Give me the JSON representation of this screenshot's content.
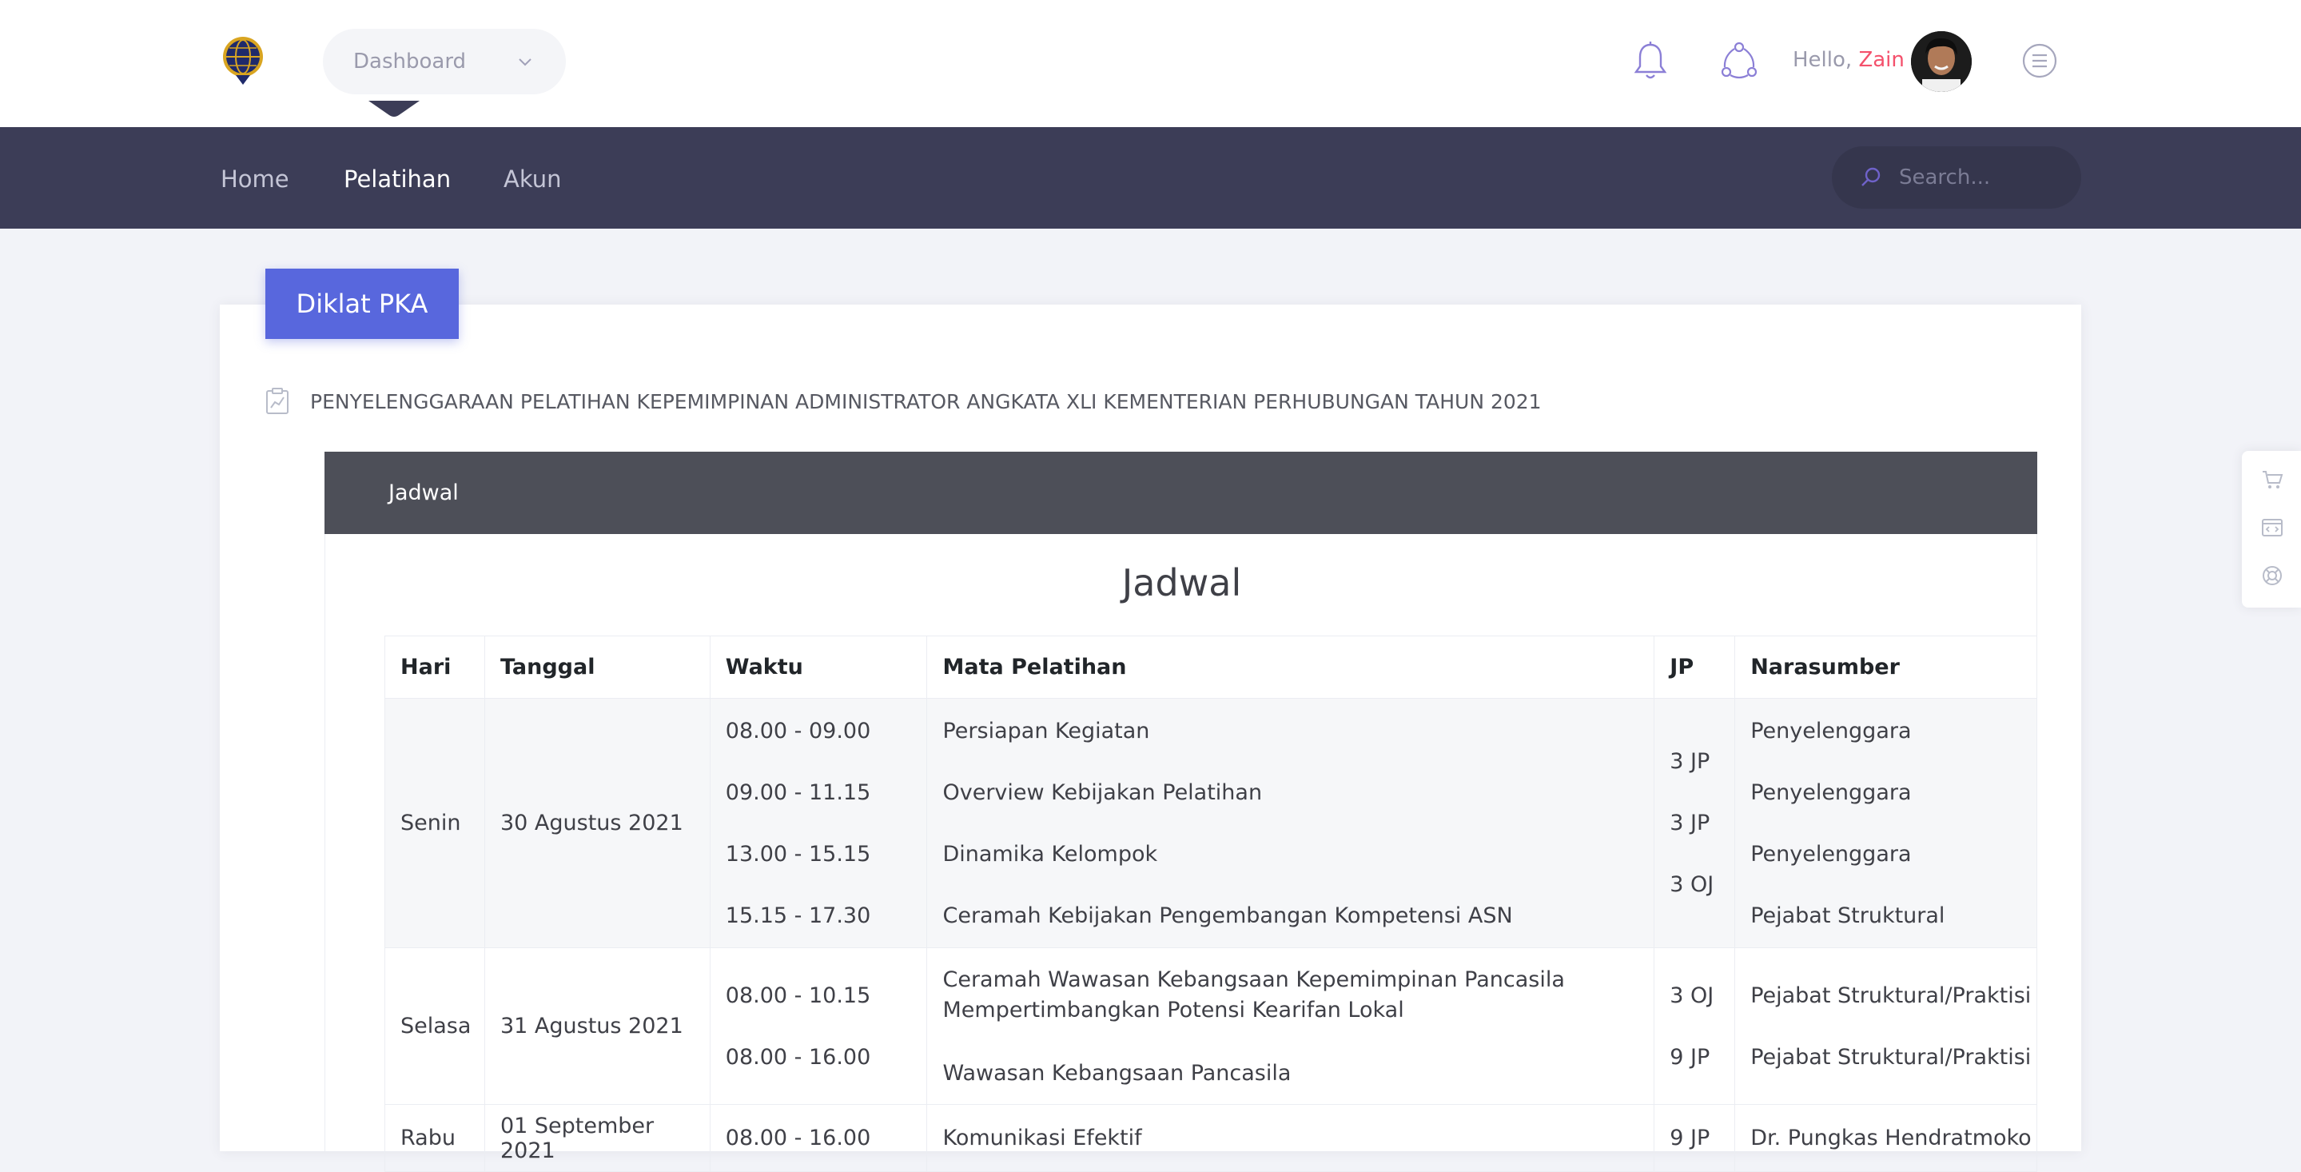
{
  "header": {
    "dashboard_select": "Dashboard",
    "greeting": "Hello,",
    "user_name": "Zain"
  },
  "nav": {
    "items": [
      {
        "label": "Home"
      },
      {
        "label": "Pelatihan"
      },
      {
        "label": "Akun"
      }
    ],
    "active_index": 1,
    "search_placeholder": "Search..."
  },
  "main": {
    "tab_label": "Diklat PKA",
    "course_title": "PENYELENGGARAAN PELATIHAN KEPEMIMPINAN ADMINISTRATOR ANGKATA XLI KEMENTERIAN PERHUBUNGAN TAHUN 2021",
    "section_header": "Jadwal",
    "table_title": "Jadwal",
    "columns": [
      "Hari",
      "Tanggal",
      "Waktu",
      "Mata Pelatihan",
      "JP",
      "Narasumber"
    ],
    "rows": [
      {
        "hari": "Senin",
        "tanggal": "30 Agustus 2021",
        "waktu": [
          "08.00 - 09.00",
          "09.00 - 11.15",
          "13.00 - 15.15",
          "15.15 - 17.30"
        ],
        "mata": [
          "Persiapan Kegiatan",
          "Overview Kebijakan Pelatihan",
          "Dinamika Kelompok",
          "Ceramah Kebijakan Pengembangan Kompetensi ASN"
        ],
        "jp": [
          "3 JP",
          "3 JP",
          "3 OJ"
        ],
        "narasumber": [
          "Penyelenggara",
          "Penyelenggara",
          "Penyelenggara",
          "Pejabat Struktural"
        ]
      },
      {
        "hari": "Selasa",
        "tanggal": "31 Agustus 2021",
        "waktu": [
          "08.00 - 10.15",
          "08.00 - 16.00"
        ],
        "mata": [
          "Ceramah Wawasan Kebangsaan Kepemimpinan Pancasila Mempertimbangkan Potensi Kearifan Lokal",
          "Wawasan Kebangsaan Pancasila"
        ],
        "jp": [
          "3 OJ",
          "9 JP"
        ],
        "narasumber": [
          "Pejabat Struktural/Praktisi",
          "Pejabat Struktural/Praktisi"
        ]
      },
      {
        "hari": "Rabu",
        "tanggal": "01 September 2021",
        "waktu": [
          "08.00 - 16.00"
        ],
        "mata": [
          "Komunikasi Efektif"
        ],
        "jp": [
          "9 JP"
        ],
        "narasumber": [
          "Dr. Pungkas Hendratmoko"
        ]
      }
    ]
  },
  "colors": {
    "accent": "#5867dd",
    "nav_bg": "#3c3d57",
    "user_name": "#f4516c",
    "section_header_bg": "#4d4f58"
  }
}
